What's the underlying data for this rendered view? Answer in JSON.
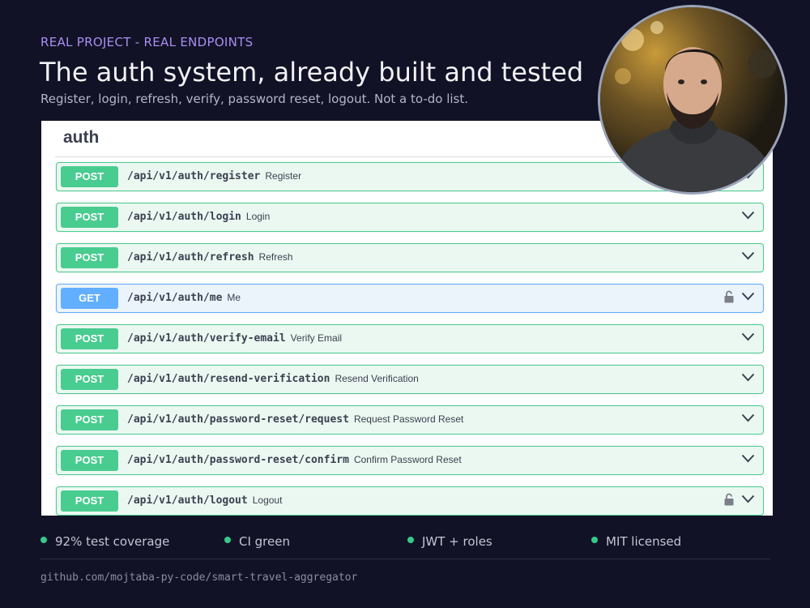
{
  "header": {
    "eyebrow": "REAL PROJECT - REAL ENDPOINTS",
    "title": "The auth system, already built and tested",
    "subtitle": "Register, login, refresh, verify, password reset, logout. Not a to-do list."
  },
  "swagger": {
    "section_title": "auth",
    "operations": [
      {
        "method": "POST",
        "path": "/api/v1/auth/register",
        "summary": "Register",
        "locked": false
      },
      {
        "method": "POST",
        "path": "/api/v1/auth/login",
        "summary": "Login",
        "locked": false
      },
      {
        "method": "POST",
        "path": "/api/v1/auth/refresh",
        "summary": "Refresh",
        "locked": false
      },
      {
        "method": "GET",
        "path": "/api/v1/auth/me",
        "summary": "Me",
        "locked": true
      },
      {
        "method": "POST",
        "path": "/api/v1/auth/verify-email",
        "summary": "Verify Email",
        "locked": false
      },
      {
        "method": "POST",
        "path": "/api/v1/auth/resend-verification",
        "summary": "Resend Verification",
        "locked": false
      },
      {
        "method": "POST",
        "path": "/api/v1/auth/password-reset/request",
        "summary": "Request Password Reset",
        "locked": false
      },
      {
        "method": "POST",
        "path": "/api/v1/auth/password-reset/confirm",
        "summary": "Confirm Password Reset",
        "locked": false
      },
      {
        "method": "POST",
        "path": "/api/v1/auth/logout",
        "summary": "Logout",
        "locked": true
      }
    ]
  },
  "footer": {
    "badges": [
      "92% test coverage",
      "CI green",
      "JWT + roles",
      "MIT licensed"
    ],
    "repo": "github.com/mojtaba-py-code/smart-travel-aggregator"
  },
  "colors": {
    "background": "#111225",
    "accent": "#a98df2",
    "post": "#49cc90",
    "get": "#61affe",
    "status_dot": "#36c98a"
  },
  "icons": [
    "chevron-down-icon",
    "lock-icon",
    "status-dot-icon",
    "avatar-photo"
  ]
}
